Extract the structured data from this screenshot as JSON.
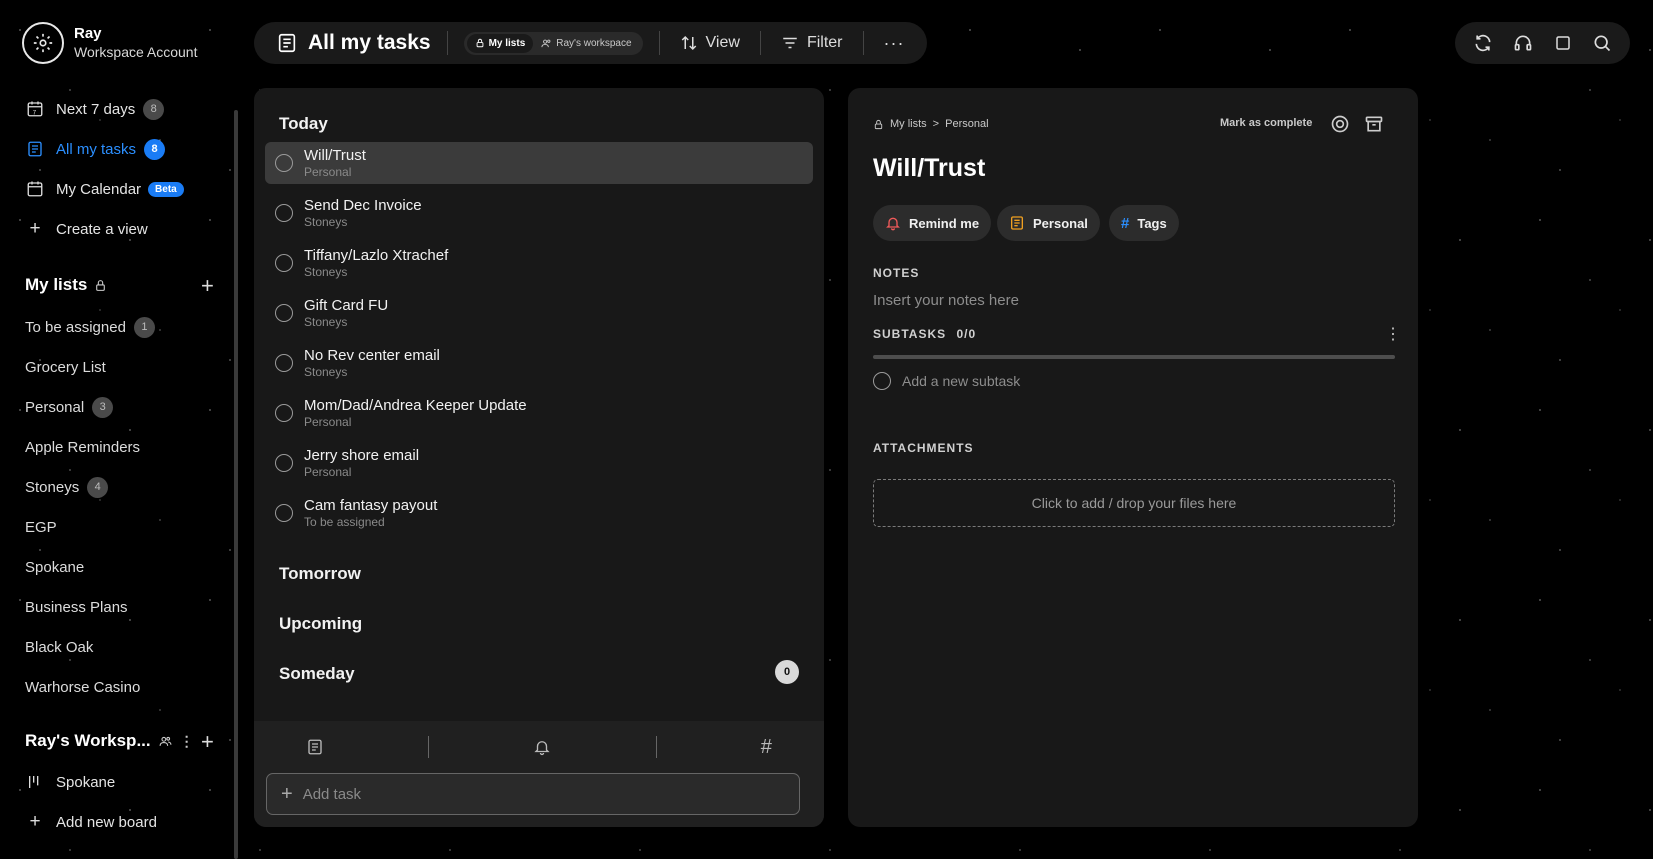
{
  "account": {
    "name": "Ray",
    "type": "Workspace Account"
  },
  "nav": [
    {
      "label": "Next 7 days",
      "badge": "8",
      "icon": "calendar-7-icon"
    },
    {
      "label": "All my tasks",
      "badge": "8",
      "icon": "tasks-icon",
      "active": true
    },
    {
      "label": "My Calendar",
      "tag": "Beta",
      "icon": "calendar-icon"
    },
    {
      "label": "Create a view",
      "icon": "plus-icon"
    }
  ],
  "my_lists": {
    "title": "My lists",
    "items": [
      {
        "label": "To be assigned",
        "badge": "1"
      },
      {
        "label": "Grocery List"
      },
      {
        "label": "Personal",
        "badge": "3"
      },
      {
        "label": "Apple Reminders"
      },
      {
        "label": "Stoneys",
        "badge": "4"
      },
      {
        "label": "EGP"
      },
      {
        "label": "Spokane"
      },
      {
        "label": "Business Plans"
      },
      {
        "label": "Black Oak"
      },
      {
        "label": "Warhorse Casino"
      }
    ]
  },
  "workspace": {
    "title": "Ray's Worksp...",
    "boards": [
      {
        "label": "Spokane"
      }
    ],
    "add_board": "Add new board"
  },
  "topbar": {
    "title": "All my tasks",
    "seg_my": "My lists",
    "seg_ws": "Ray's workspace",
    "view": "View",
    "filter": "Filter",
    "more": "···"
  },
  "groups": {
    "today": "Today",
    "tomorrow": "Tomorrow",
    "upcoming": "Upcoming",
    "someday": "Someday",
    "someday_count": "0"
  },
  "tasks": [
    {
      "title": "Will/Trust",
      "list": "Personal",
      "selected": true
    },
    {
      "title": "Send Dec Invoice",
      "list": "Stoneys"
    },
    {
      "title": "Tiffany/Lazlo Xtrachef",
      "list": "Stoneys"
    },
    {
      "title": "Gift Card FU",
      "list": "Stoneys"
    },
    {
      "title": "No Rev center email",
      "list": "Stoneys"
    },
    {
      "title": "Mom/Dad/Andrea Keeper Update",
      "list": "Personal"
    },
    {
      "title": "Jerry shore email",
      "list": "Personal"
    },
    {
      "title": "Cam fantasy payout",
      "list": "To be assigned"
    }
  ],
  "add_task": {
    "placeholder": "Add task"
  },
  "detail": {
    "crumb_root": "My lists",
    "crumb_sep": ">",
    "crumb_list": "Personal",
    "mark_complete": "Mark as complete",
    "title": "Will/Trust",
    "chip_remind": "Remind me",
    "chip_list": "Personal",
    "chip_tags": "Tags",
    "notes_label": "NOTES",
    "notes_placeholder": "Insert your notes here",
    "subtasks_label": "SUBTASKS",
    "subtasks_count": "0/0",
    "subtask_placeholder": "Add a new subtask",
    "attachments_label": "ATTACHMENTS",
    "dropzone": "Click to add / drop your files here"
  },
  "colors": {
    "accent": "#1a7cf5",
    "remind": "#f05a5a",
    "personal": "#f0a020",
    "tags": "#2b8fff"
  }
}
